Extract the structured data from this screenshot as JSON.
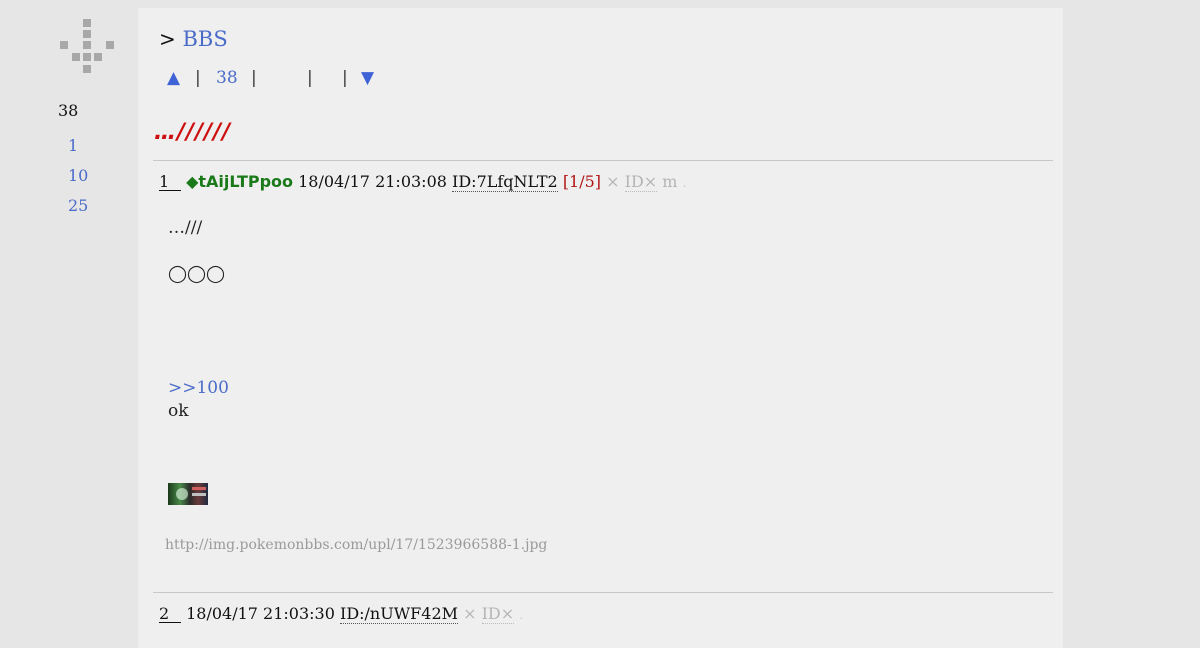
{
  "sidebar": {
    "count": "38",
    "links": [
      "1",
      "10",
      "25"
    ]
  },
  "breadcrumb": {
    "separator": ">",
    "board": "BBS"
  },
  "nav": {
    "up_arrow": "▲",
    "count": "38",
    "separator": "|",
    "down_arrow": "▼"
  },
  "thread_title": "…//////",
  "posts": [
    {
      "number": "1",
      "trip": "◆tAijLTPpoo",
      "datetime": "18/04/17 21:03:08",
      "id": "ID:7LfqNLT2",
      "post_count": "[1/5]",
      "ng_mark": "×",
      "id_ng": "ID×",
      "mail": "m",
      "trailing_dot": ".",
      "lines": [
        "…///",
        "◯◯◯"
      ],
      "anchor": ">>100",
      "reply": "ok",
      "image_url": "http://img.pokemonbbs.com/upl/17/1523966588-1.jpg"
    },
    {
      "number": "2",
      "datetime": "18/04/17 21:03:30",
      "id": "ID:/nUWF42M",
      "ng_mark": "×",
      "id_ng": "ID×",
      "trailing_dot": "."
    }
  ],
  "colors": {
    "link": "#4a6bc8",
    "title": "#cc1010",
    "trip": "#1a7a1a",
    "post_count": "#b01515",
    "muted": "#b5b5b5"
  },
  "icons": {
    "logo": "plus-cross-pixel-logo",
    "up": "triangle-up-icon",
    "down": "triangle-down-icon"
  }
}
